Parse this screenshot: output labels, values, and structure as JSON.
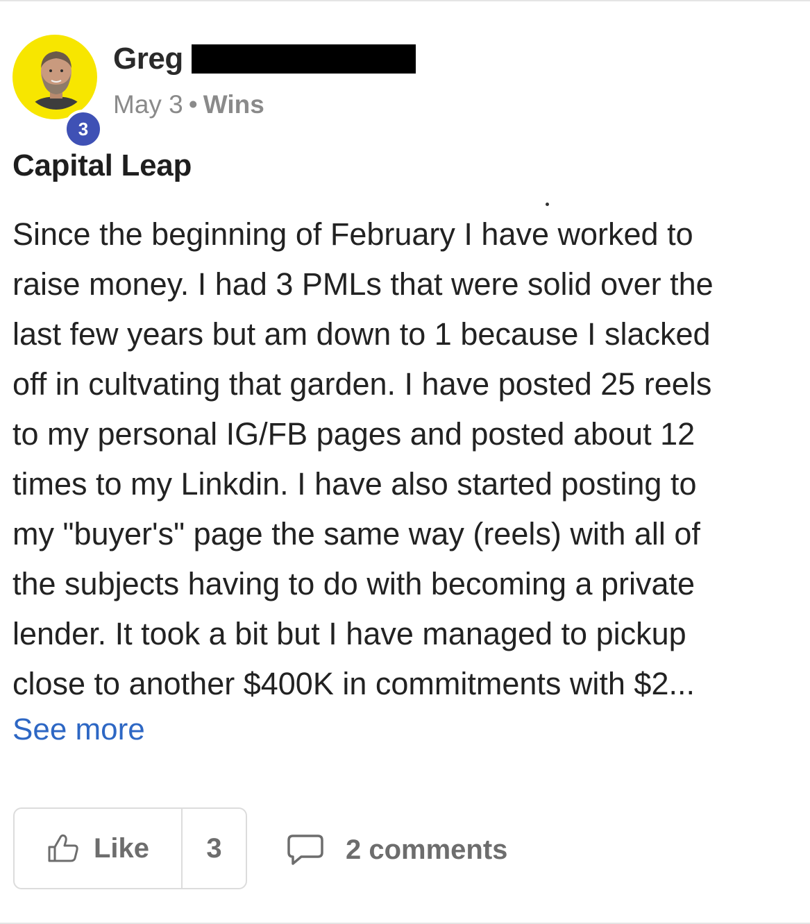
{
  "author": {
    "name": "Greg",
    "level": "3"
  },
  "meta": {
    "date": "May 3",
    "separator": "•",
    "category": "Wins"
  },
  "post": {
    "title": "Capital Leap",
    "body_lines": [
      "Since the beginning of February I have worked to",
      "raise money. I had 3 PMLs that were solid over the",
      "last few years but am down to 1 because I slacked",
      "off in cultvating that garden. I have posted 25 reels",
      "to my personal IG/FB pages and posted about 12",
      "times to my Linkdin. I have also started posting to",
      "my \"buyer's\" page the same way (reels) with all of",
      "the subjects having to do with becoming a private",
      "lender. It took a bit but I have managed to pickup",
      "close to another $400K in commitments with $2..."
    ],
    "see_more": "See more"
  },
  "actions": {
    "like_label": "Like",
    "like_count": "3",
    "comments_label": "2 comments"
  },
  "colors": {
    "avatar_ring": "#f7e600",
    "level_badge": "#3f51b5",
    "link": "#2d67c4",
    "muted": "#8a8a8a"
  },
  "icons": {
    "like": "thumbs-up-icon",
    "comments": "speech-bubble-icon"
  }
}
